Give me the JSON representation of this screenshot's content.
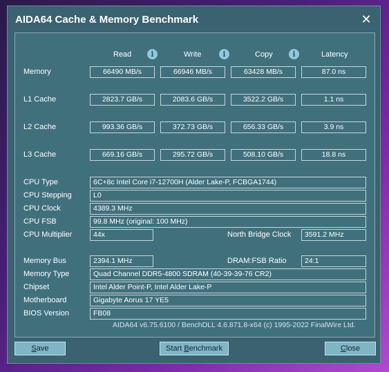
{
  "window": {
    "title": "AIDA64 Cache & Memory Benchmark",
    "close_glyph": "✕"
  },
  "columns": {
    "read": "Read",
    "write": "Write",
    "copy": "Copy",
    "latency": "Latency"
  },
  "info_glyph": "i",
  "rows": [
    {
      "label": "Memory",
      "read": "66490 MB/s",
      "write": "66946 MB/s",
      "copy": "63428 MB/s",
      "latency": "87.0 ns"
    },
    {
      "label": "L1 Cache",
      "read": "2823.7 GB/s",
      "write": "2083.6 GB/s",
      "copy": "3522.2 GB/s",
      "latency": "1.1 ns"
    },
    {
      "label": "L2 Cache",
      "read": "993.36 GB/s",
      "write": "372.73 GB/s",
      "copy": "656.33 GB/s",
      "latency": "3.9 ns"
    },
    {
      "label": "L3 Cache",
      "read": "669.16 GB/s",
      "write": "295.72 GB/s",
      "copy": "508.10 GB/s",
      "latency": "18.8 ns"
    }
  ],
  "cpu": {
    "type_label": "CPU Type",
    "type_value": "6C+8c Intel Core i7-12700H  (Alder Lake-P, FCBGA1744)",
    "stepping_label": "CPU Stepping",
    "stepping_value": "L0",
    "clock_label": "CPU Clock",
    "clock_value": "4389.3 MHz",
    "fsb_label": "CPU FSB",
    "fsb_value": "99.8 MHz  (original: 100 MHz)",
    "multiplier_label": "CPU Multiplier",
    "multiplier_value": "44x",
    "nb_clock_label": "North Bridge Clock",
    "nb_clock_value": "3591.2 MHz"
  },
  "system": {
    "bus_label": "Memory Bus",
    "bus_value": "2394.1 MHz",
    "ratio_label": "DRAM:FSB Ratio",
    "ratio_value": "24:1",
    "memtype_label": "Memory Type",
    "memtype_value": "Quad Channel DDR5-4800 SDRAM  (40-39-39-76 CR2)",
    "chipset_label": "Chipset",
    "chipset_value": "Intel Alder Point-P, Intel Alder Lake-P",
    "motherboard_label": "Motherboard",
    "motherboard_value": "Gigabyte Aorus 17 YE5",
    "bios_label": "BIOS Version",
    "bios_value": "FB08"
  },
  "footer": "AIDA64 v6.75.6100 / BenchDLL 4.6.871.8-x64  (c) 1995-2022 FinalWire Ltd.",
  "buttons": {
    "save_u": "S",
    "save_rest": "ave",
    "start_pre": "Start ",
    "start_u": "B",
    "start_rest": "enchmark",
    "close_u": "C",
    "close_rest": "lose"
  }
}
